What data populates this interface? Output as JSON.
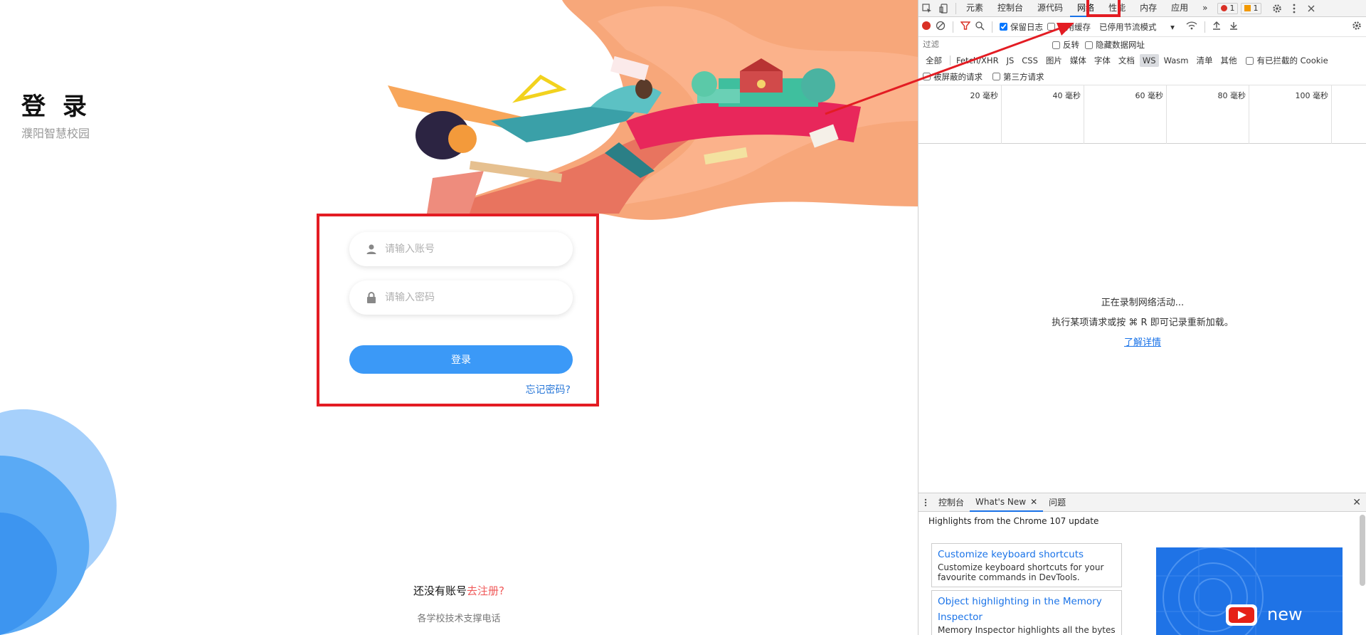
{
  "page": {
    "title": "登 录",
    "subtitle": "濮阳智慧校园",
    "account_placeholder": "请输入账号",
    "password_placeholder": "请输入密码",
    "login_label": "登录",
    "forgot_label": "忘记密码?",
    "register_prefix": "还没有账号",
    "register_link": "去注册?",
    "footer_note": "各学校技术支撑电话"
  },
  "devtools": {
    "tabs": [
      "元素",
      "控制台",
      "源代码",
      "网络",
      "性能",
      "内存",
      "应用"
    ],
    "active_tab": "网络",
    "more": "»",
    "error_count": "1",
    "warning_count": "1",
    "toolbar": {
      "preserve_log": "保留日志",
      "disable_cache": "停用缓存",
      "throttle": "已停用节流模式"
    },
    "filter": {
      "placeholder": "过滤",
      "invert": "反转",
      "hide_data_urls": "隐藏数据网址"
    },
    "types": [
      "全部",
      "Fetch/XHR",
      "JS",
      "CSS",
      "图片",
      "媒体",
      "字体",
      "文档",
      "WS",
      "Wasm",
      "清单",
      "其他"
    ],
    "selected_type": "WS",
    "blocked_cookies": "有已拦截的 Cookie",
    "blocked_requests": "被屏蔽的请求",
    "third_party": "第三方请求",
    "timeline_ticks": [
      "20 毫秒",
      "40 毫秒",
      "60 毫秒",
      "80 毫秒",
      "100 毫秒"
    ],
    "empty_line1": "正在录制网络活动...",
    "empty_line2": "执行某项请求或按 ⌘ R 即可记录重新加载。",
    "learn_more": "了解详情",
    "drawer": {
      "tabs": [
        "控制台",
        "What's New",
        "问题"
      ],
      "active_tab": "What's New",
      "highlights": "Highlights from the Chrome 107 update",
      "cards": [
        {
          "title": "Customize keyboard shortcuts",
          "desc": "Customize keyboard shortcuts for your favourite commands in DevTools."
        },
        {
          "title": "Object highlighting in the Memory Inspector",
          "desc": "Memory Inspector highlights all the bytes"
        }
      ],
      "promo_text": "new"
    }
  },
  "colors": {
    "primary": "#3b99f7",
    "annotation_red": "#e31c23",
    "link_blue": "#1a73e8",
    "register_red": "#f05a5a"
  }
}
